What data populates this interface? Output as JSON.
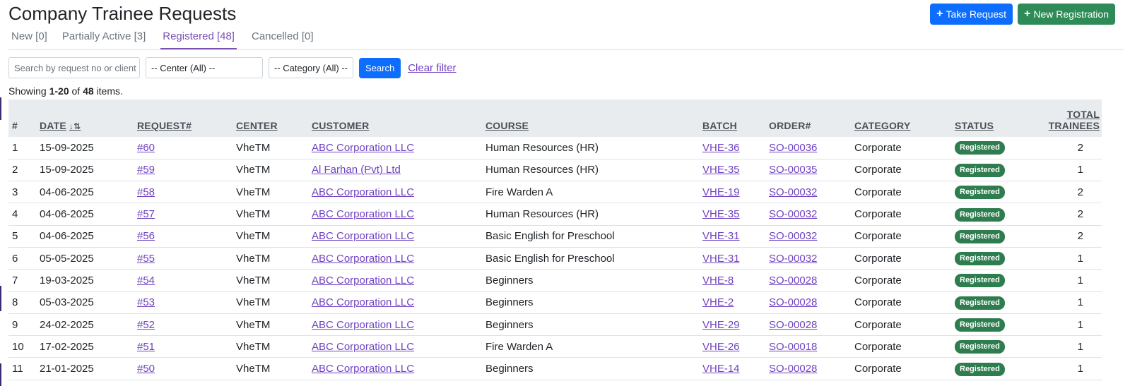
{
  "page": {
    "title": "Company Trainee Requests",
    "take_request_label": "Take Request",
    "new_registration_label": "New Registration"
  },
  "tabs": [
    {
      "label": "New [0]"
    },
    {
      "label": "Partially Active [3]"
    },
    {
      "label": "Registered [48]",
      "active": true
    },
    {
      "label": "Cancelled [0]"
    }
  ],
  "filters": {
    "search_placeholder": "Search by request no or client",
    "center_value": "-- Center (All) --",
    "category_value": "-- Category (All) --",
    "search_button": "Search",
    "clear_filter": "Clear filter"
  },
  "summary": {
    "prefix": "Showing ",
    "range": "1-20",
    "of": " of ",
    "total": "48",
    "suffix": " items."
  },
  "table": {
    "columns": {
      "num": "#",
      "date": "DATE",
      "request": "REQUEST#",
      "center": "CENTER",
      "customer": "CUSTOMER",
      "course": "COURSE",
      "batch": "BATCH",
      "order": "ORDER#",
      "category": "CATEGORY",
      "status": "STATUS",
      "total_line1": "TOTAL",
      "total_line2": "TRAINEES"
    },
    "rows": [
      {
        "num": "1",
        "date": "15-09-2025",
        "request": "#60",
        "center": "VheTM",
        "customer": "ABC Corporation LLC",
        "course": "Human Resources (HR)",
        "batch": "VHE-36",
        "order": "SO-00036",
        "category": "Corporate",
        "status": "Registered",
        "total": "2"
      },
      {
        "num": "2",
        "date": "15-09-2025",
        "request": "#59",
        "center": "VheTM",
        "customer": "Al Farhan (Pvt) Ltd",
        "course": "Human Resources (HR)",
        "batch": "VHE-35",
        "order": "SO-00035",
        "category": "Corporate",
        "status": "Registered",
        "total": "1"
      },
      {
        "num": "3",
        "date": "04-06-2025",
        "request": "#58",
        "center": "VheTM",
        "customer": "ABC Corporation LLC",
        "course": "Fire Warden A",
        "batch": "VHE-19",
        "order": "SO-00032",
        "category": "Corporate",
        "status": "Registered",
        "total": "2"
      },
      {
        "num": "4",
        "date": "04-06-2025",
        "request": "#57",
        "center": "VheTM",
        "customer": "ABC Corporation LLC",
        "course": "Human Resources (HR)",
        "batch": "VHE-35",
        "order": "SO-00032",
        "category": "Corporate",
        "status": "Registered",
        "total": "2"
      },
      {
        "num": "5",
        "date": "04-06-2025",
        "request": "#56",
        "center": "VheTM",
        "customer": "ABC Corporation LLC",
        "course": "Basic English for Preschool",
        "batch": "VHE-31",
        "order": "SO-00032",
        "category": "Corporate",
        "status": "Registered",
        "total": "2"
      },
      {
        "num": "6",
        "date": "05-05-2025",
        "request": "#55",
        "center": "VheTM",
        "customer": "ABC Corporation LLC",
        "course": "Basic English for Preschool",
        "batch": "VHE-31",
        "order": "SO-00032",
        "category": "Corporate",
        "status": "Registered",
        "total": "1"
      },
      {
        "num": "7",
        "date": "19-03-2025",
        "request": "#54",
        "center": "VheTM",
        "customer": "ABC Corporation LLC",
        "course": "Beginners",
        "batch": "VHE-8",
        "order": "SO-00028",
        "category": "Corporate",
        "status": "Registered",
        "total": "1"
      },
      {
        "num": "8",
        "date": "05-03-2025",
        "request": "#53",
        "center": "VheTM",
        "customer": "ABC Corporation LLC",
        "course": "Beginners",
        "batch": "VHE-2",
        "order": "SO-00028",
        "category": "Corporate",
        "status": "Registered",
        "total": "1"
      },
      {
        "num": "9",
        "date": "24-02-2025",
        "request": "#52",
        "center": "VheTM",
        "customer": "ABC Corporation LLC",
        "course": "Beginners",
        "batch": "VHE-29",
        "order": "SO-00028",
        "category": "Corporate",
        "status": "Registered",
        "total": "1"
      },
      {
        "num": "10",
        "date": "17-02-2025",
        "request": "#51",
        "center": "VheTM",
        "customer": "ABC Corporation LLC",
        "course": "Fire Warden A",
        "batch": "VHE-26",
        "order": "SO-00018",
        "category": "Corporate",
        "status": "Registered",
        "total": "1"
      },
      {
        "num": "11",
        "date": "21-01-2025",
        "request": "#50",
        "center": "VheTM",
        "customer": "ABC Corporation LLC",
        "course": "Beginners",
        "batch": "VHE-14",
        "order": "SO-00028",
        "category": "Corporate",
        "status": "Registered",
        "total": "1"
      }
    ]
  },
  "colors": {
    "primary": "#0d6efd",
    "success": "#2e8b57",
    "tab_active": "#7a4fb3",
    "link": "#6f42c1",
    "badge": "#2e7d4f",
    "header_bg": "#e9ecef"
  },
  "icons": {
    "plus": "plus-icon",
    "sort": "sort-desc-icon"
  }
}
